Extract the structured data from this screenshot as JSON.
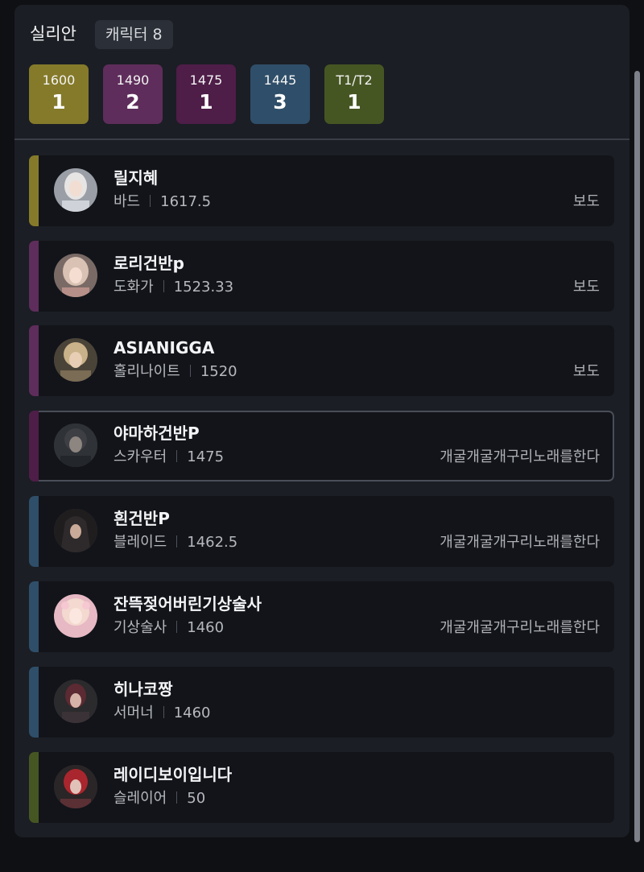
{
  "header": {
    "server": "실리안",
    "character_count": "캐릭터 8"
  },
  "tiers": [
    {
      "label": "1600",
      "count": "1",
      "color": "#857a2a"
    },
    {
      "label": "1490",
      "count": "2",
      "color": "#5e2d5b"
    },
    {
      "label": "1475",
      "count": "1",
      "color": "#4e1d48"
    },
    {
      "label": "1445",
      "count": "3",
      "color": "#2f4e69"
    },
    {
      "label": "T1/T2",
      "count": "1",
      "color": "#465623"
    }
  ],
  "characters": [
    {
      "name": "릴지혜",
      "class": "바드",
      "level": "1617.5",
      "guild": "보도",
      "accent": "#857a2a",
      "avatar": "avatar-bard-icon",
      "selected": false
    },
    {
      "name": "로리건반p",
      "class": "도화가",
      "level": "1523.33",
      "guild": "보도",
      "accent": "#5e2d5b",
      "avatar": "avatar-artist-icon",
      "selected": false
    },
    {
      "name": "ASIANIGGA",
      "class": "홀리나이트",
      "level": "1520",
      "guild": "보도",
      "accent": "#5e2d5b",
      "avatar": "avatar-paladin-icon",
      "selected": false
    },
    {
      "name": "야마하건반P",
      "class": "스카우터",
      "level": "1475",
      "guild": "개굴개굴개구리노래를한다",
      "accent": "#4e1d48",
      "avatar": "avatar-scouter-icon",
      "selected": true
    },
    {
      "name": "흰건반P",
      "class": "블레이드",
      "level": "1462.5",
      "guild": "개굴개굴개구리노래를한다",
      "accent": "#2f4e69",
      "avatar": "avatar-blade-icon",
      "selected": false
    },
    {
      "name": "잔뜩젖어버린기상술사",
      "class": "기상술사",
      "level": "1460",
      "guild": "개굴개굴개구리노래를한다",
      "accent": "#2f4e69",
      "avatar": "avatar-aeromancer-icon",
      "selected": false
    },
    {
      "name": "히나코짱",
      "class": "서머너",
      "level": "1460",
      "guild": "",
      "accent": "#2f4e69",
      "avatar": "avatar-summoner-icon",
      "selected": false
    },
    {
      "name": "레이디보이입니다",
      "class": "슬레이어",
      "level": "50",
      "guild": "",
      "accent": "#465623",
      "avatar": "avatar-slayer-icon",
      "selected": false
    }
  ]
}
